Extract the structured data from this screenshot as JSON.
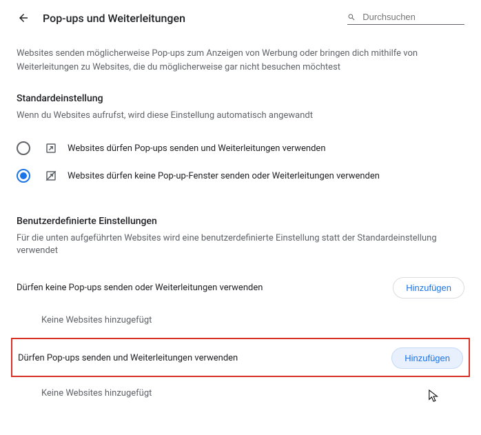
{
  "header": {
    "title": "Pop-ups und Weiterleitungen",
    "search_placeholder": "Durchsuchen"
  },
  "intro": "Websites senden möglicherweise Pop-ups zum Anzeigen von Werbung oder bringen dich mithilfe von Weiterleitungen zu Websites, die du möglicherweise gar nicht besuchen möchtest",
  "default_section": {
    "title": "Standardeinstellung",
    "desc": "Wenn du Websites aufrufst, wird diese Einstellung automatisch angewandt",
    "options": [
      {
        "label": "Websites dürfen Pop-ups senden und Weiterleitungen verwenden",
        "selected": false
      },
      {
        "label": "Websites dürfen keine Pop-up-Fenster senden oder Weiterleitungen verwenden",
        "selected": true
      }
    ]
  },
  "custom_section": {
    "title": "Benutzerdefinierte Einstellungen",
    "desc": "Für die unten aufgeführten Websites wird eine benutzerdefinierte Einstellung statt der Standardeinstellung verwendet",
    "block_list": {
      "label": "Dürfen keine Pop-ups senden oder Weiterleitungen verwenden",
      "add_label": "Hinzufügen",
      "empty": "Keine Websites hinzugefügt"
    },
    "allow_list": {
      "label": "Dürfen Pop-ups senden und Weiterleitungen verwenden",
      "add_label": "Hinzufügen",
      "empty": "Keine Websites hinzugefügt"
    }
  },
  "colors": {
    "accent": "#1a73e8",
    "highlight": "#d93025"
  }
}
